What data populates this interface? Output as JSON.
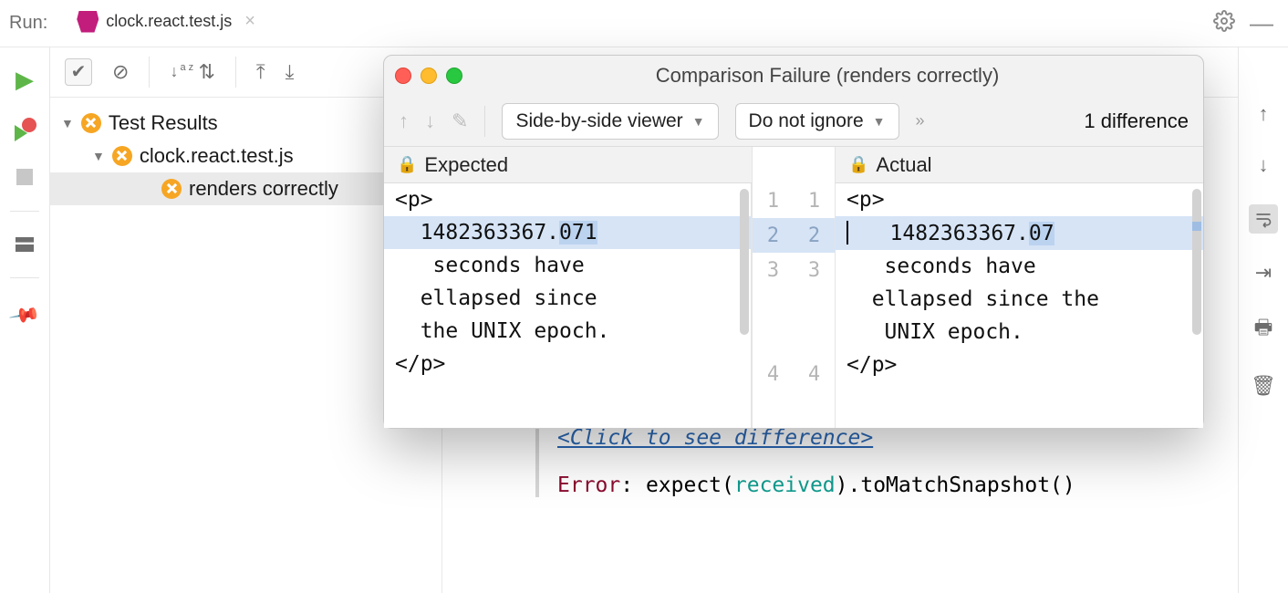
{
  "topbar": {
    "run_label": "Run:",
    "tab_title": "clock.react.test.js"
  },
  "tree": {
    "root": "Test Results",
    "file": "clock.react.test.js",
    "test": "renders correctly"
  },
  "dialog": {
    "title": "Comparison Failure (renders correctly)",
    "viewer_mode": "Side-by-side viewer",
    "ignore_mode": "Do not ignore",
    "diff_count": "1 difference",
    "expected_label": "Expected",
    "actual_label": "Actual",
    "expected": {
      "l1": "<p>",
      "l2_pre": "  1482363367.",
      "l2_hl": "071",
      "l3": "   seconds have",
      "l3b": "  ellapsed since",
      "l3c": "  the UNIX epoch.",
      "l4": "</p>"
    },
    "actual": {
      "l1": "<p>",
      "l2_pre": "   1482363367.",
      "l2_hl": "07",
      "l3": "   seconds have",
      "l3b": "  ellapsed since the",
      "l3c": "   UNIX epoch.",
      "l4": "</p>"
    },
    "line_numbers": {
      "n1": "1",
      "n2": "2",
      "n3": "3",
      "n4": "4"
    }
  },
  "console": {
    "link": "<Click to see difference>",
    "error_word": "Error",
    "expect_pre": ": expect(",
    "received": "received",
    "expect_post": ").toMatchSnapshot()"
  }
}
